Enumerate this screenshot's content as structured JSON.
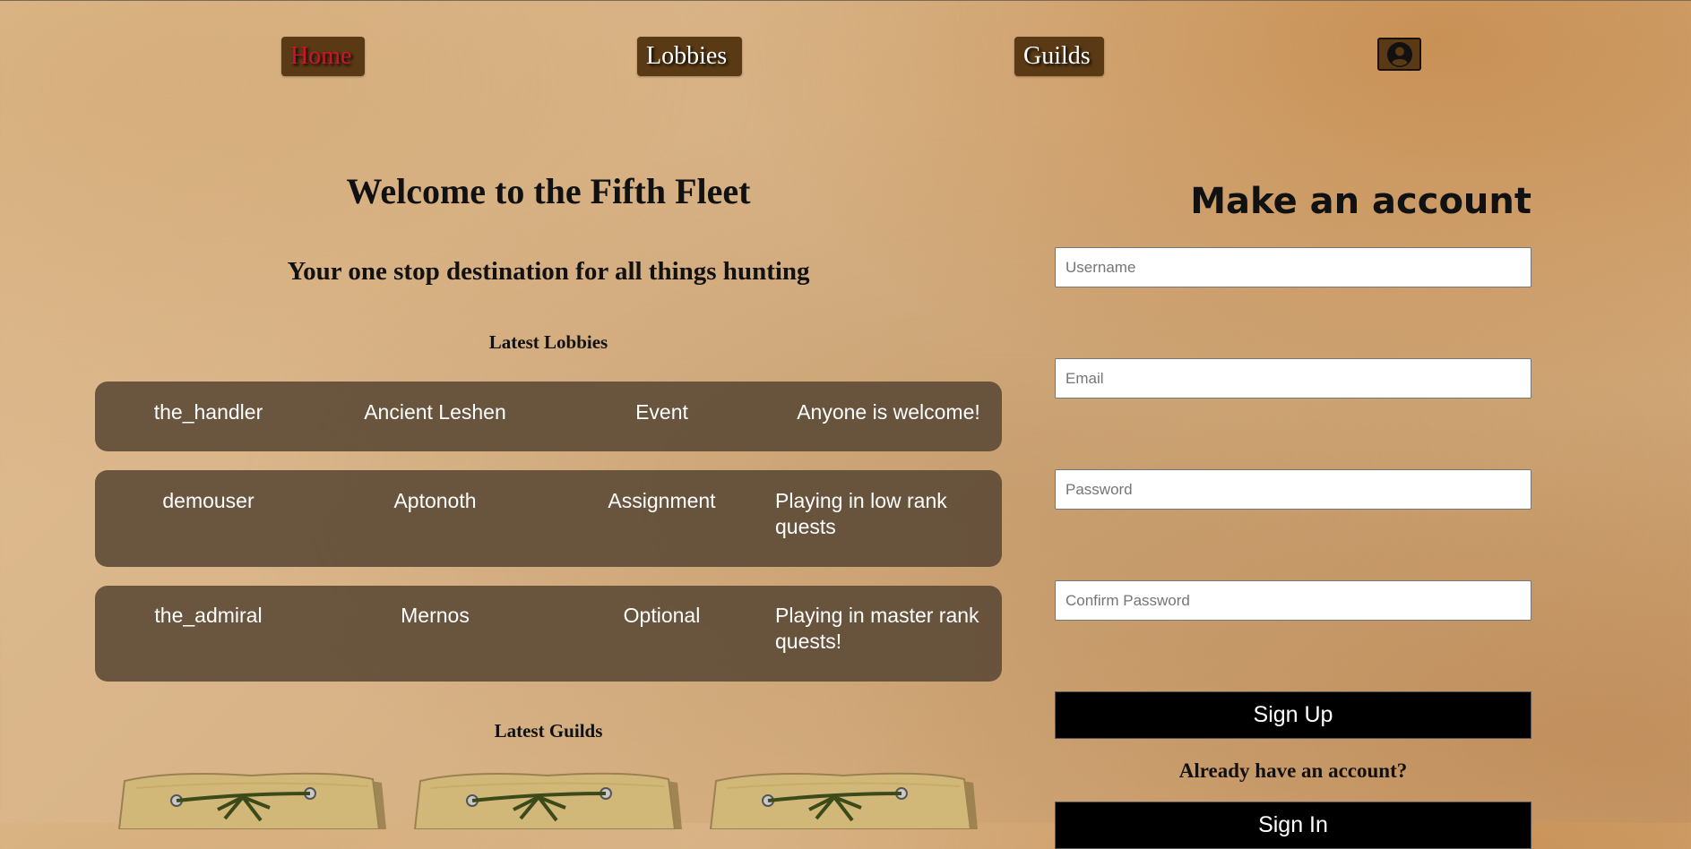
{
  "nav": {
    "items": [
      {
        "label": "Home",
        "active": true
      },
      {
        "label": "Lobbies",
        "active": false
      },
      {
        "label": "Guilds",
        "active": false
      }
    ],
    "account_icon": "user-circle-icon",
    "active_color": "#d0132a",
    "button_color": "#5a3a14"
  },
  "main": {
    "title": "Welcome to the Fifth Fleet",
    "tagline": "Your one stop destination for all things hunting",
    "latest_lobbies_heading": "Latest Lobbies",
    "lobbies": [
      {
        "user": "the_handler",
        "monster": "Ancient Leshen",
        "type": "Event",
        "description": "Anyone is welcome!"
      },
      {
        "user": "demouser",
        "monster": "Aptonoth",
        "type": "Assignment",
        "description": "Playing in low rank quests"
      },
      {
        "user": "the_admiral",
        "monster": "Mernos",
        "type": "Optional",
        "description": "Playing in master rank quests!"
      }
    ],
    "latest_guilds_heading": "Latest Guilds"
  },
  "signup": {
    "title": "Make an account",
    "username_placeholder": "Username",
    "email_placeholder": "Email",
    "password_placeholder": "Password",
    "confirm_password_placeholder": "Confirm Password",
    "sign_up_label": "Sign Up",
    "already_text": "Already have an account?",
    "sign_in_label": "Sign In"
  }
}
